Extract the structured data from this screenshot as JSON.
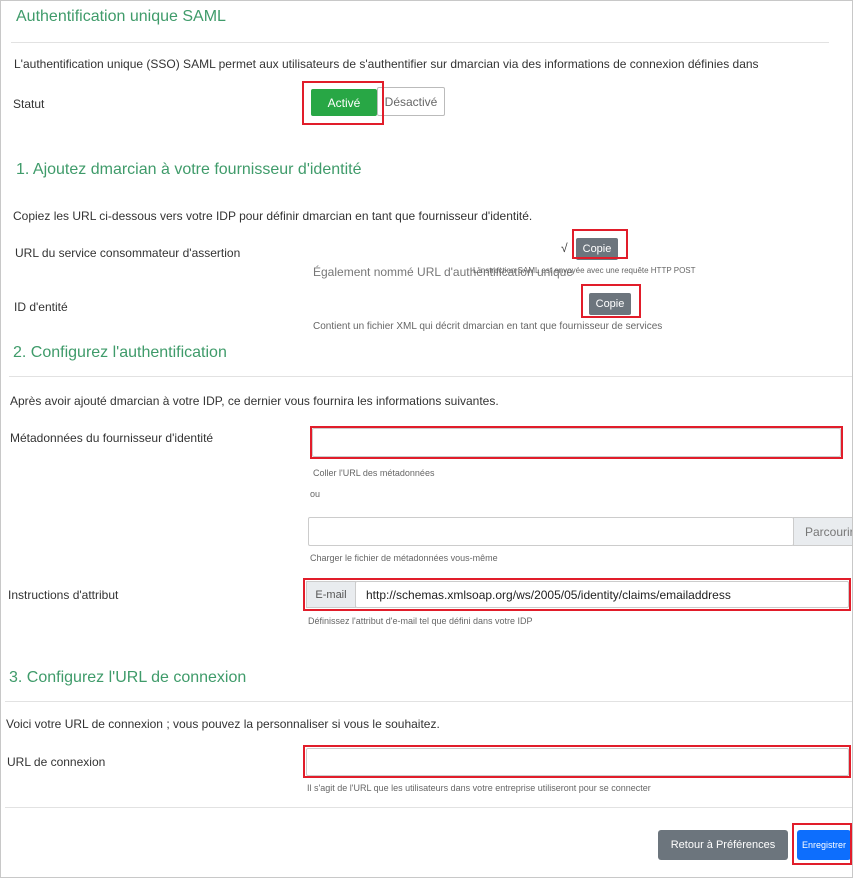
{
  "page": {
    "title": "Authentification unique SAML",
    "intro": "L'authentification unique (SSO) SAML permet aux utilisateurs de s'authentifier sur dmarcian via des informations de connexion définies dans",
    "status_label": "Statut",
    "status_on": "Activé",
    "status_off": "Désactivé"
  },
  "section1": {
    "heading": "1. Ajoutez dmarcian à votre fournisseur d'identité",
    "desc": "Copiez les URL ci-dessous vers votre IDP pour définir dmarcian en tant que fournisseur d'identité.",
    "acs_label": "URL du service consommateur d'assertion",
    "acs_prefix": "√",
    "copy_label": "Copie",
    "acs_help_a": "Également nommé URL d'authentification unique",
    "acs_help_b": "L'instruction SAML est envoyée avec une requête HTTP POST",
    "entity_label": "ID d'entité",
    "entity_help": "Contient un fichier XML qui décrit dmarcian en tant que fournisseur de services"
  },
  "section2": {
    "heading": "2. Configurez l'authentification",
    "desc": "Après avoir ajouté dmarcian à votre IDP, ce dernier vous fournira les informations suivantes.",
    "metadata_label": "Métadonnées du fournisseur d'identité",
    "metadata_value": "",
    "metadata_help": "Coller l'URL des métadonnées",
    "or_text": "ou",
    "browse_label": "Parcourir",
    "upload_help": "Charger le fichier de métadonnées vous-même",
    "attr_label": "Instructions d'attribut",
    "attr_addon": "E-mail",
    "attr_value": "http://schemas.xmlsoap.org/ws/2005/05/identity/claims/emailaddress",
    "attr_help": "Définissez l'attribut d'e-mail tel que défini dans votre IDP"
  },
  "section3": {
    "heading": "3. Configurez l'URL de connexion",
    "desc": "Voici votre URL de connexion ; vous pouvez la personnaliser si vous le souhaitez.",
    "login_label": "URL de connexion",
    "login_value": "",
    "login_help": "Il s'agit de l'URL que les utilisateurs dans votre entreprise utiliseront pour se connecter"
  },
  "footer": {
    "back_label": "Retour à Préférences",
    "save_label": "Enregistrer"
  }
}
